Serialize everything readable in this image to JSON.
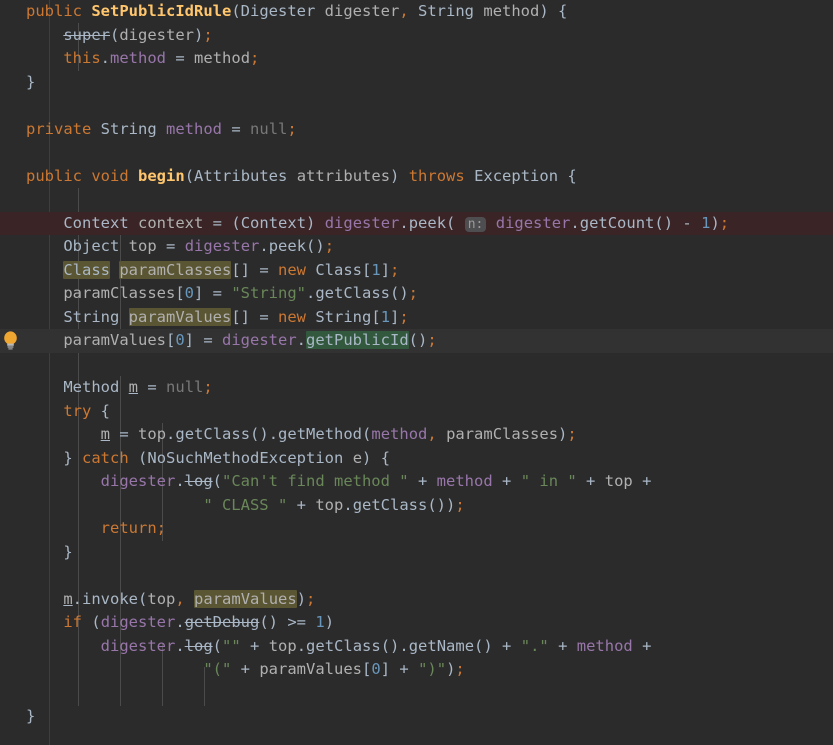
{
  "editor": {
    "language": "java",
    "theme": "darcula",
    "background": "#2b2b2b",
    "default_text_color": "#a9b7c6",
    "caret_line_color": "#3a2426",
    "usage_write_highlight": "#5a5532",
    "usage_read_highlight": "#32593d",
    "keyword_color": "#cc7832",
    "string_color": "#6a8759",
    "number_color": "#6897bb",
    "field_color": "#9876aa",
    "method_decl_color": "#ffc66d",
    "param_hint_bg": "#4e4e50",
    "param_hint_text": "#9a9a9a"
  },
  "gutter": {
    "intention_icon": "lightbulb-icon",
    "intention_icon_color": "#f0a732",
    "intention_icon_line": 15
  },
  "code_lines": [
    {
      "n": 1,
      "indent": 0,
      "text": "public SetPublicIdRule(Digester digester, String method) {"
    },
    {
      "n": 2,
      "indent": 1,
      "text": "super(digester);"
    },
    {
      "n": 3,
      "indent": 1,
      "text": "this.method = method;"
    },
    {
      "n": 4,
      "indent": 0,
      "text": "}"
    },
    {
      "n": 5,
      "indent": 0,
      "text": ""
    },
    {
      "n": 6,
      "indent": 0,
      "text": "private String method = null;"
    },
    {
      "n": 7,
      "indent": 0,
      "text": ""
    },
    {
      "n": 8,
      "indent": 0,
      "text": "public void begin(Attributes attributes) throws Exception {"
    },
    {
      "n": 9,
      "indent": 0,
      "text": ""
    },
    {
      "n": 10,
      "indent": 1,
      "text": "Context context = (Context) digester.peek( n: digester.getCount() - 1);"
    },
    {
      "n": 11,
      "indent": 1,
      "text": "Object top = digester.peek();"
    },
    {
      "n": 12,
      "indent": 1,
      "text": "Class paramClasses[] = new Class[1];"
    },
    {
      "n": 13,
      "indent": 1,
      "text": "paramClasses[0] = \"String\".getClass();"
    },
    {
      "n": 14,
      "indent": 1,
      "text": "String paramValues[] = new String[1];"
    },
    {
      "n": 15,
      "indent": 1,
      "text": "paramValues[0] = digester.getPublicId();"
    },
    {
      "n": 16,
      "indent": 0,
      "text": ""
    },
    {
      "n": 17,
      "indent": 1,
      "text": "Method m = null;"
    },
    {
      "n": 18,
      "indent": 1,
      "text": "try {"
    },
    {
      "n": 19,
      "indent": 2,
      "text": "m = top.getClass().getMethod(method, paramClasses);"
    },
    {
      "n": 20,
      "indent": 1,
      "text": "} catch (NoSuchMethodException e) {"
    },
    {
      "n": 21,
      "indent": 2,
      "text": "digester.log(\"Can't find method \" + method + \" in \" + top +"
    },
    {
      "n": 22,
      "indent": 2,
      "text": "             \" CLASS \" + top.getClass());"
    },
    {
      "n": 23,
      "indent": 2,
      "text": "return;"
    },
    {
      "n": 24,
      "indent": 1,
      "text": "}"
    },
    {
      "n": 25,
      "indent": 0,
      "text": ""
    },
    {
      "n": 26,
      "indent": 1,
      "text": "m.invoke(top, paramValues);"
    },
    {
      "n": 27,
      "indent": 1,
      "text": "if (digester.getDebug() >= 1)"
    },
    {
      "n": 28,
      "indent": 2,
      "text": "digester.log(\"\" + top.getClass().getName() + \".\" + method +"
    },
    {
      "n": 29,
      "indent": 2,
      "text": "             \"(\" + paramValues[0] + \")\");"
    },
    {
      "n": 30,
      "indent": 0,
      "text": ""
    },
    {
      "n": 31,
      "indent": 0,
      "text": "}"
    }
  ],
  "inline_hints": [
    {
      "line": 10,
      "label": "n:"
    }
  ],
  "deprecated_tokens": [
    "super",
    "log",
    "getDebug"
  ],
  "highlighted_identifiers": {
    "write_usages": [
      "Class",
      "paramClasses",
      "paramValues"
    ],
    "read_usages": [
      "getPublicId"
    ]
  },
  "caret_line": 10,
  "soft_highlight_line": 15
}
